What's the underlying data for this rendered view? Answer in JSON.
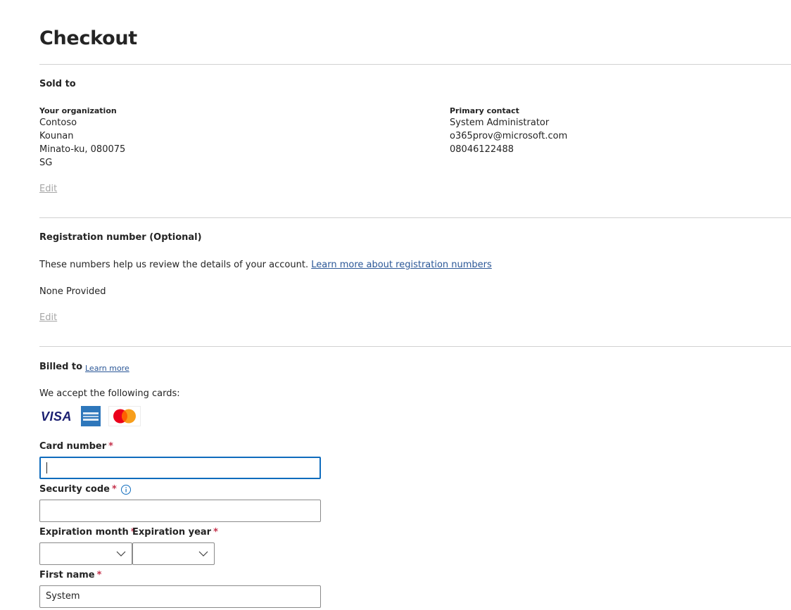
{
  "page": {
    "title": "Checkout"
  },
  "sold_to": {
    "heading": "Sold to",
    "organization": {
      "label": "Your organization",
      "lines": [
        "Contoso",
        "Kounan",
        "Minato-ku, 080075",
        "SG"
      ]
    },
    "primary_contact": {
      "label": "Primary contact",
      "lines": [
        "System Administrator",
        "o365prov@microsoft.com",
        "08046122488"
      ]
    },
    "edit_label": "Edit"
  },
  "registration": {
    "heading": "Registration number (Optional)",
    "description": "These numbers help us review the details of your account.",
    "learn_more": "Learn more about registration numbers",
    "value": "None Provided",
    "edit_label": "Edit"
  },
  "billed_to": {
    "heading": "Billed to",
    "learn_more": "Learn more",
    "accept_text": "We accept the following cards:",
    "cards": [
      {
        "name": "VISA",
        "icon": "visa-logo",
        "color": "#1a1f71"
      },
      {
        "name": "American Express",
        "icon": "amex-logo",
        "color": "#2e77bb"
      },
      {
        "name": "Mastercard",
        "icon": "mastercard-logo",
        "color": "#eb001b"
      }
    ],
    "fields": {
      "card_number": {
        "label": "Card number",
        "value": ""
      },
      "security_code": {
        "label": "Security code",
        "value": ""
      },
      "expiration_month": {
        "label": "Expiration month",
        "value": ""
      },
      "expiration_year": {
        "label": "Expiration year",
        "value": ""
      },
      "first_name": {
        "label": "First name",
        "value": "System"
      }
    },
    "required_marker": "*"
  },
  "colors": {
    "accent": "#0f6cbd",
    "link": "#2b5797",
    "required": "#c4314b",
    "muted": "#a6a6a6"
  }
}
